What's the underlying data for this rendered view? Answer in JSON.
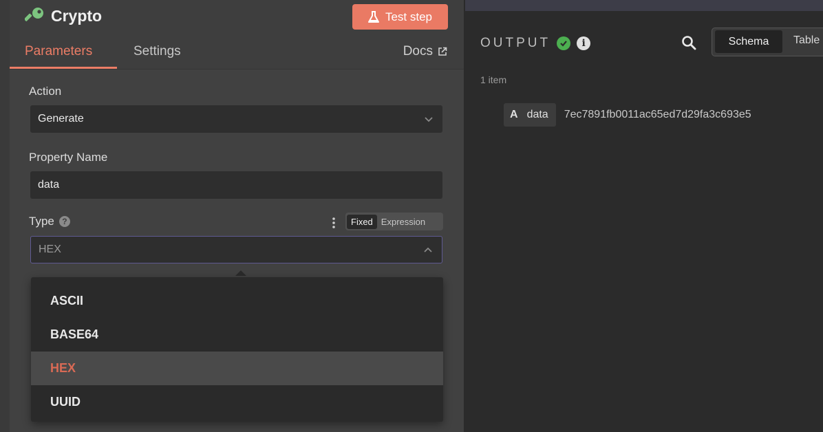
{
  "node": {
    "title": "Crypto",
    "test_step_label": "Test step",
    "accent_color": "#ea7a64"
  },
  "tabs": {
    "parameters": "Parameters",
    "settings": "Settings",
    "docs": "Docs"
  },
  "params": {
    "action": {
      "label": "Action",
      "value": "Generate"
    },
    "property_name": {
      "label": "Property Name",
      "value": "data"
    },
    "type": {
      "label": "Type",
      "value": "HEX",
      "mode_fixed": "Fixed",
      "mode_expression": "Expression",
      "options": [
        "ASCII",
        "BASE64",
        "HEX",
        "UUID"
      ],
      "selected_option": "HEX"
    }
  },
  "output": {
    "title": "OUTPUT",
    "view_schema": "Schema",
    "view_table": "Table",
    "item_count": "1 item",
    "field_type_icon": "A",
    "field_name": "data",
    "field_value": "7ec7891fb0011ac65ed7d29fa3c693e5"
  },
  "icons": {
    "node": "key-icon",
    "test_step": "flask-icon",
    "docs": "external-link-icon",
    "help": "question-circle-icon",
    "more": "more-vertical-icon",
    "success": "check-circle-icon",
    "info": "info-circle-icon",
    "search": "search-icon"
  }
}
